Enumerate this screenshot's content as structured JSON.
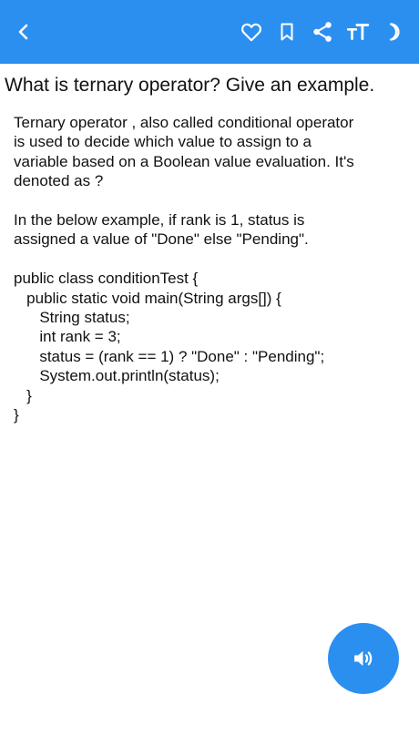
{
  "header": {
    "icons": [
      "chevron-left-icon",
      "heart-icon",
      "bookmark-icon",
      "share-icon",
      "text-size-icon",
      "moon-icon"
    ],
    "accent_color": "#2b8ff0"
  },
  "question": {
    "title": "What is ternary operator? Give an example."
  },
  "answer": {
    "paragraph1": [
      "Ternary operator , also called conditional operator",
      "is used to decide which value to assign to a",
      "variable based on a Boolean value evaluation. It's",
      "denoted as ?"
    ],
    "paragraph2": [
      "In the below example, if rank is 1, status is",
      "assigned a value of \"Done\" else \"Pending\"."
    ],
    "code": [
      "public class conditionTest {",
      "   public static void main(String args[]) {",
      "      String status;",
      "      int rank = 3;",
      "      status = (rank == 1) ? \"Done\" : \"Pending\";",
      "      System.out.println(status);",
      "   }",
      "}"
    ]
  },
  "fab": {
    "icon": "speaker-icon"
  }
}
